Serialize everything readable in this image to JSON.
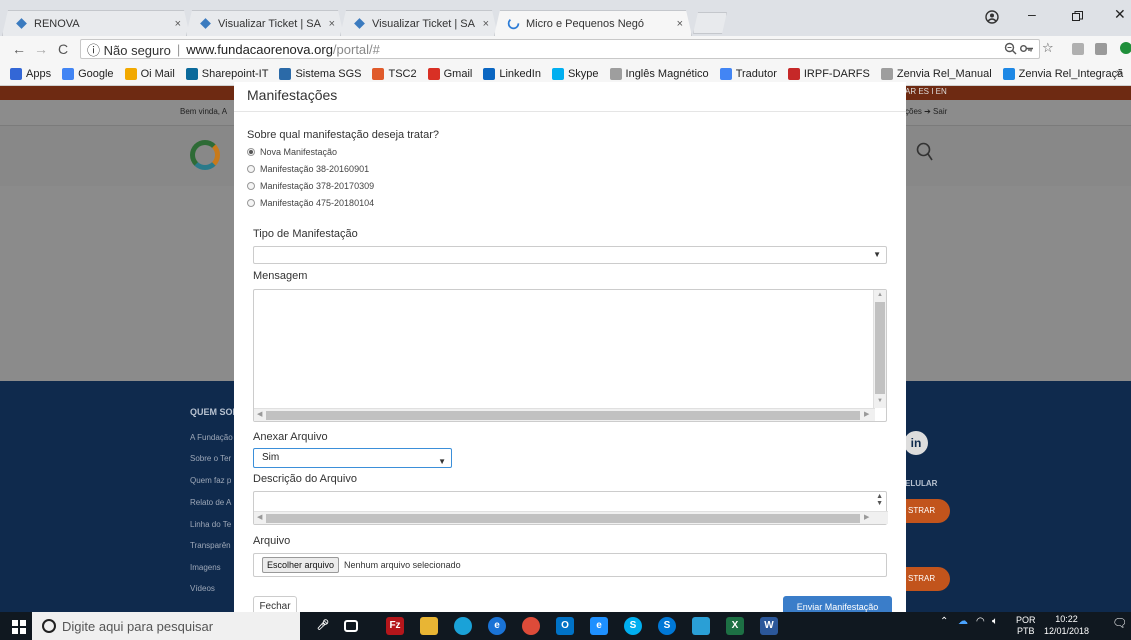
{
  "browser": {
    "tabs": [
      {
        "title": "RENOVA"
      },
      {
        "title": "Visualizar Ticket | SA Info"
      },
      {
        "title": "Visualizar Ticket | SA Info"
      },
      {
        "title": "Micro e Pequenos Negó"
      }
    ],
    "tab_close": "×",
    "address": {
      "security": "ⓘ Não seguro",
      "host": "www.fundacaorenova.org",
      "path": "/portal/#"
    },
    "bookmarks": [
      {
        "label": "Apps",
        "color": "#3367d6"
      },
      {
        "label": "Google",
        "color": "#4285f4"
      },
      {
        "label": "Oi Mail",
        "color": "#f2a900"
      },
      {
        "label": "Sharepoint-IT",
        "color": "#0b6a9b"
      },
      {
        "label": "Sistema SGS",
        "color": "#2b6aa8"
      },
      {
        "label": "TSC2",
        "color": "#e05a2a"
      },
      {
        "label": "Gmail",
        "color": "#d93025"
      },
      {
        "label": "LinkedIn",
        "color": "#0a66c2"
      },
      {
        "label": "Skype",
        "color": "#00aff0"
      },
      {
        "label": "Inglês Magnético",
        "color": "#9e9e9e"
      },
      {
        "label": "Tradutor",
        "color": "#4285f4"
      },
      {
        "label": "IRPF-DARFS",
        "color": "#c62828"
      },
      {
        "label": "Zenvia Rel_Manual",
        "color": "#9e9e9e"
      },
      {
        "label": "Zenvia Rel_Integraçã",
        "color": "#1e88e5"
      }
    ],
    "bookmarks_more": "»"
  },
  "site": {
    "lang": "AR ES I EN",
    "welcome": "Bem vinda, A",
    "exit": "ções ➔ Sair",
    "footer_head": "QUEM SOM",
    "footer_links": [
      "A Fundação",
      "Sobre o Ter",
      "Quem faz p",
      "Relato de A",
      "Linha do Te",
      "Transparên",
      "Imagens",
      "Vídeos"
    ],
    "footer_celular": "ELULAR",
    "footer_btn": "STRAR",
    "linkedin": "in"
  },
  "modal": {
    "title": "Manifestações",
    "question": "Sobre qual manifestação deseja tratar?",
    "options": [
      {
        "label": "Nova Manifestação",
        "selected": true
      },
      {
        "label": "Manifestação 38-20160901",
        "selected": false
      },
      {
        "label": "Manifestação 378-20170309",
        "selected": false
      },
      {
        "label": "Manifestação 475-20180104",
        "selected": false
      }
    ],
    "tipo_label": "Tipo de Manifestação",
    "tipo_value": "",
    "mensagem_label": "Mensagem",
    "mensagem_value": "",
    "anexar_label": "Anexar Arquivo",
    "anexar_value": "Sim",
    "descricao_label": "Descrição do Arquivo",
    "arquivo_label": "Arquivo",
    "file_button": "Escolher arquivo",
    "file_status": "Nenhum arquivo selecionado",
    "close_button": "Fechar",
    "submit_button": "Enviar Manifestação"
  },
  "taskbar": {
    "search_placeholder": "Digite aqui para pesquisar",
    "lang": "POR",
    "lang_sub": "PTB",
    "time": "10:22",
    "date": "12/01/2018"
  },
  "colors": {
    "modal_primary": "#3a7dc9",
    "footer_bg": "#0f2a4d",
    "site_accent": "#c2541c"
  }
}
